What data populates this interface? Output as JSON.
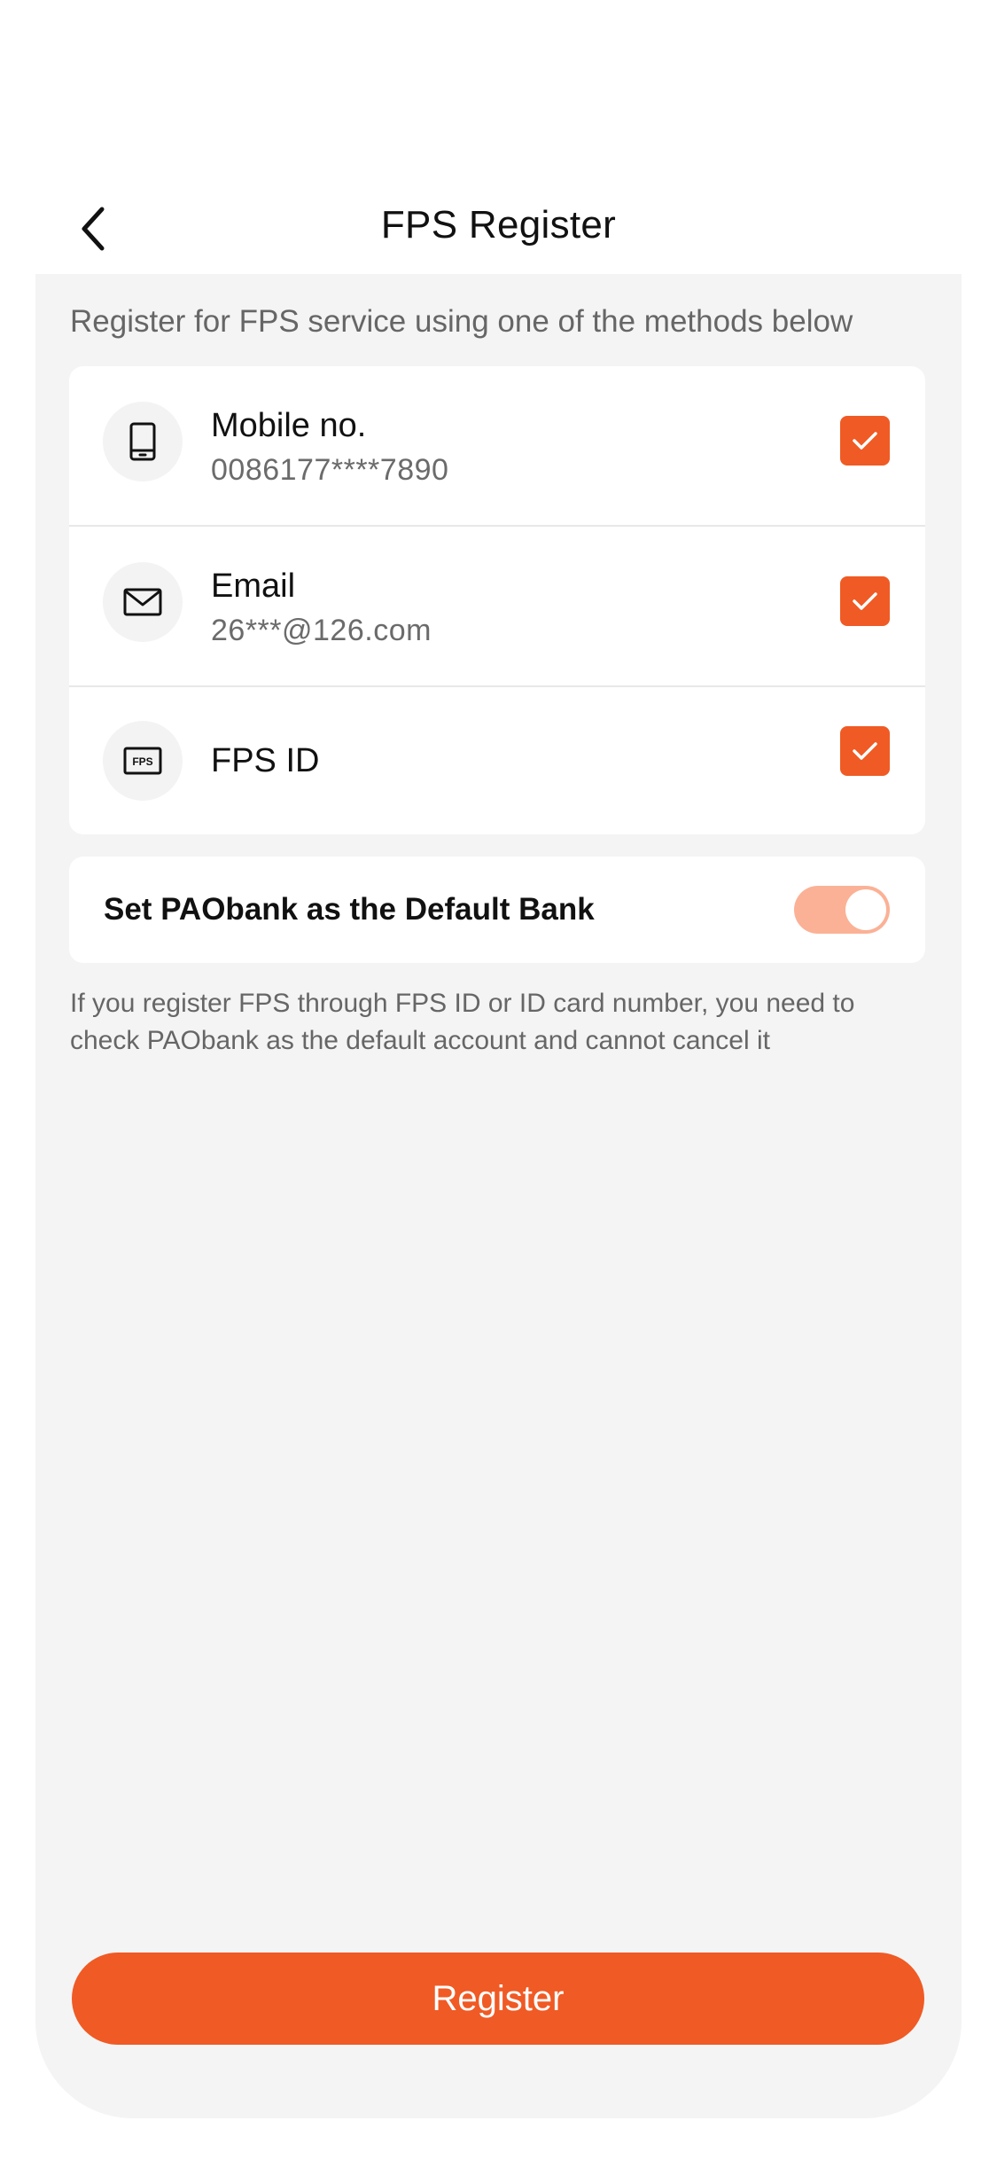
{
  "header": {
    "title": "FPS Register",
    "back_icon": "chevron-left-icon"
  },
  "intro": "Register for FPS service using one of the methods below",
  "methods": [
    {
      "label": "Mobile no.",
      "value": "0086177****7890",
      "icon": "mobile-icon",
      "checked": true
    },
    {
      "label": "Email",
      "value": "26***@126.com",
      "icon": "mail-icon",
      "checked": true
    },
    {
      "label": "FPS ID",
      "icon": "fps-icon",
      "icon_text": "FPS",
      "checked": true
    }
  ],
  "default_bank": {
    "label": "Set PAObank as the Default Bank",
    "enabled": true
  },
  "note": "If you register FPS through FPS ID or ID card number, you need to check PAObank as the default account and cannot cancel it",
  "register_button": "Register",
  "colors": {
    "accent": "#f05a24",
    "toggle_track": "#fbb196",
    "panel_background": "#f4f4f4",
    "secondary_text": "#666666"
  }
}
